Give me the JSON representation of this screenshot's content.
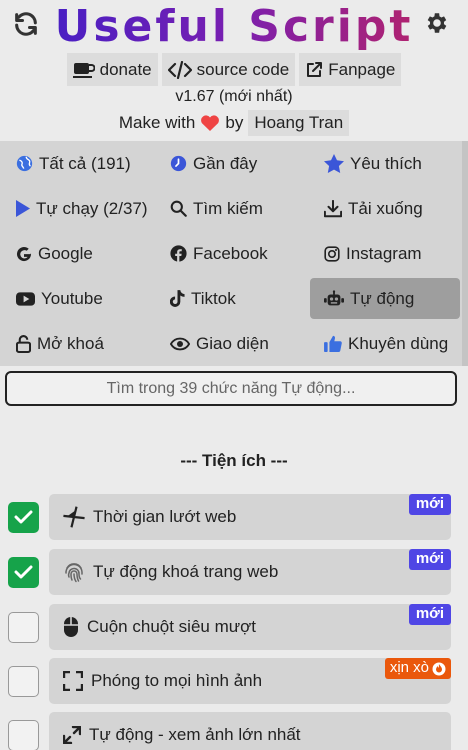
{
  "header": {
    "title": "Useful Script",
    "links": {
      "donate": "donate",
      "source_code": "source code",
      "fanpage": "Fanpage"
    },
    "version": "v1.67 (mới nhất)",
    "made_with": "Make with",
    "by": "by",
    "author": "Hoang Tran",
    "heart_color": "#ef4444"
  },
  "categories": [
    {
      "label": "Tất cả (191)",
      "icon": "globe-icon"
    },
    {
      "label": "Gần đây",
      "icon": "clock-icon"
    },
    {
      "label": "Yêu thích",
      "icon": "star-icon"
    },
    {
      "label": "Tự chạy (2/37)",
      "icon": "play-icon"
    },
    {
      "label": "Tìm kiếm",
      "icon": "search-icon"
    },
    {
      "label": "Tải xuống",
      "icon": "download-icon"
    },
    {
      "label": "Google",
      "icon": "google-icon"
    },
    {
      "label": "Facebook",
      "icon": "facebook-icon"
    },
    {
      "label": "Instagram",
      "icon": "instagram-icon"
    },
    {
      "label": "Youtube",
      "icon": "youtube-icon"
    },
    {
      "label": "Tiktok",
      "icon": "tiktok-icon"
    },
    {
      "label": "Tự động",
      "icon": "robot-icon",
      "active": true
    },
    {
      "label": "Mở khoá",
      "icon": "unlock-icon"
    },
    {
      "label": "Giao diện",
      "icon": "eye-icon"
    },
    {
      "label": "Khuyên dùng",
      "icon": "thumbs-up-icon"
    }
  ],
  "search": {
    "placeholder": "Tìm trong 39 chức năng Tự động..."
  },
  "section": {
    "title": "--- Tiện ích ---"
  },
  "features": [
    {
      "label": "Thời gian lướt web",
      "icon": "hourglass-icon",
      "checked": true,
      "badge": "mới"
    },
    {
      "label": "Tự động khoá trang web",
      "icon": "fingerprint-icon",
      "checked": true,
      "badge": "mới"
    },
    {
      "label": "Cuộn chuột siêu mượt",
      "icon": "mouse-icon",
      "checked": false,
      "badge": "mới"
    },
    {
      "label": "Phóng to mọi hình ảnh",
      "icon": "expand-icon",
      "checked": false,
      "badge": "xịn xò"
    },
    {
      "label": "Tự động - xem ảnh lớn nhất",
      "icon": "arrows-diagonal-icon",
      "checked": false,
      "badge": ""
    }
  ],
  "colors": {
    "accent": "#4f46e5",
    "check": "#16a34a",
    "hot": "#ea580c"
  }
}
